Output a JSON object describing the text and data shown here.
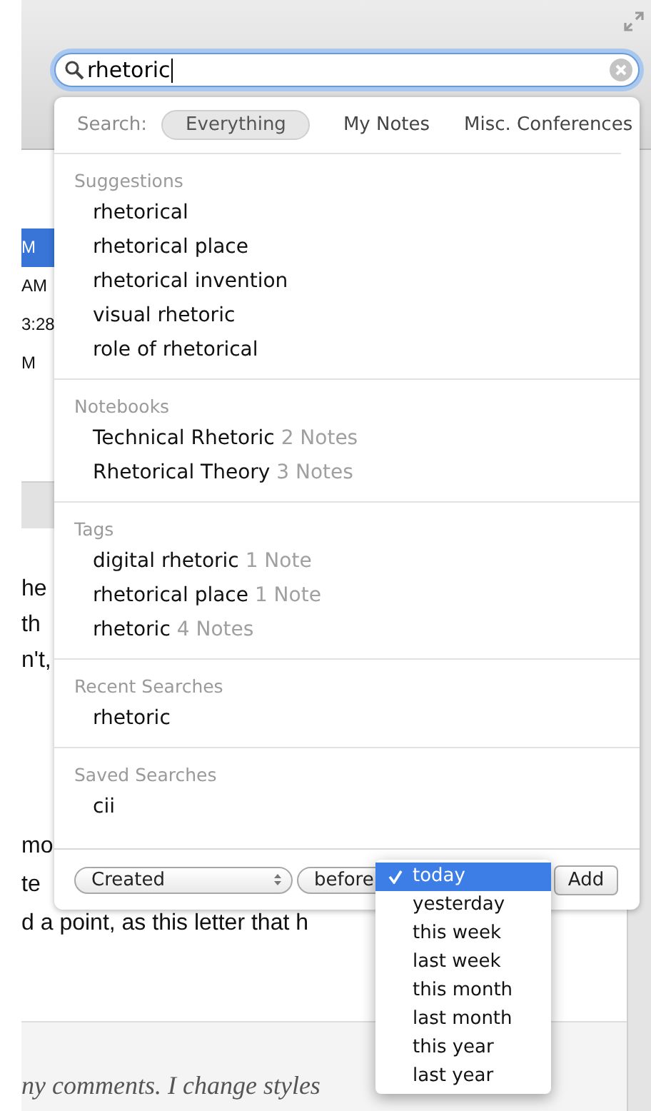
{
  "toolbar": {
    "search_field": {
      "value": "rhetoric"
    }
  },
  "note_list": {
    "rows": [
      {
        "text": "M",
        "selected": true
      },
      {
        "text": "AM",
        "selected": false
      },
      {
        "text": "3:28",
        "selected": false
      },
      {
        "text": "M",
        "selected": false
      }
    ]
  },
  "note_body": {
    "paragraphs": [
      [
        "he",
        "th",
        "n't,"
      ],
      [
        "mo",
        "te",
        "d a point, as this letter that h"
      ]
    ]
  },
  "footer_text": "ny comments. I change styles",
  "search_popup": {
    "scope_label": "Search:",
    "scopes": [
      {
        "label": "Everything",
        "selected": true
      },
      {
        "label": "My Notes",
        "selected": false
      },
      {
        "label": "Misc. Conferences",
        "selected": false
      }
    ],
    "sections": [
      {
        "title": "Suggestions",
        "items": [
          {
            "label": "rhetorical"
          },
          {
            "label": "rhetorical place"
          },
          {
            "label": "rhetorical invention"
          },
          {
            "label": "visual rhetoric"
          },
          {
            "label": "role of rhetorical"
          }
        ]
      },
      {
        "title": "Notebooks",
        "items": [
          {
            "label": "Technical Rhetoric",
            "count": "2 Notes"
          },
          {
            "label": "Rhetorical Theory",
            "count": "3 Notes"
          }
        ]
      },
      {
        "title": "Tags",
        "items": [
          {
            "label": "digital rhetoric",
            "count": "1 Note"
          },
          {
            "label": "rhetorical place",
            "count": "1 Note"
          },
          {
            "label": "rhetoric",
            "count": "4 Notes"
          }
        ]
      },
      {
        "title": "Recent Searches",
        "items": [
          {
            "label": "rhetoric"
          }
        ]
      },
      {
        "title": "Saved Searches",
        "items": [
          {
            "label": "cii"
          }
        ]
      }
    ],
    "filter": {
      "field": "Created",
      "operator": "before",
      "add_button": "Add"
    }
  },
  "date_menu": {
    "options": [
      {
        "label": "today",
        "selected": true
      },
      {
        "label": "yesterday",
        "selected": false
      },
      {
        "label": "this week",
        "selected": false
      },
      {
        "label": "last week",
        "selected": false
      },
      {
        "label": "this month",
        "selected": false
      },
      {
        "label": "last month",
        "selected": false
      },
      {
        "label": "this year",
        "selected": false
      },
      {
        "label": "last year",
        "selected": false
      }
    ]
  }
}
